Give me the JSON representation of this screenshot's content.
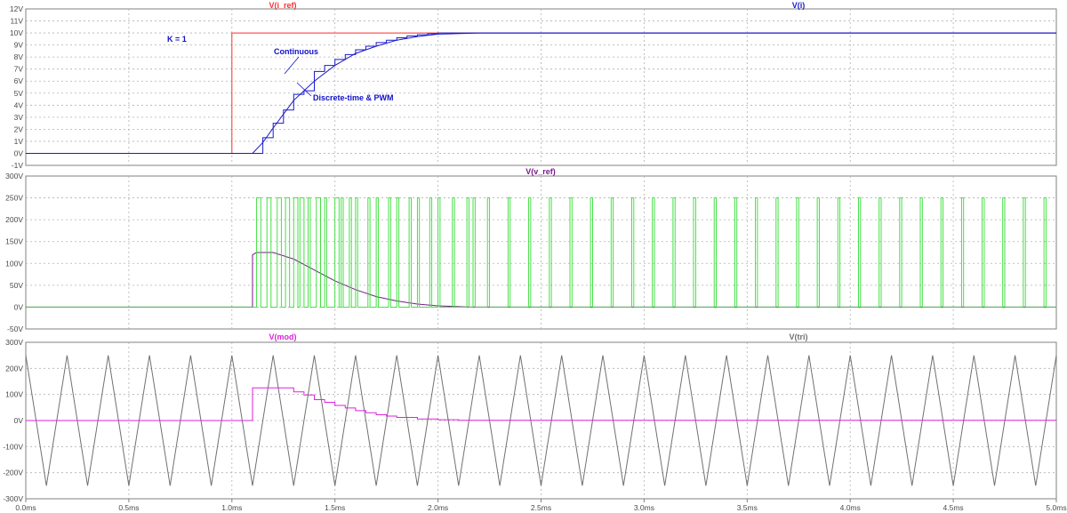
{
  "chart_data": [
    {
      "type": "line",
      "title_left": "V(i_ref)",
      "title_right": "V(i)",
      "x_unit": "ms",
      "y_unit": "V",
      "xlim": [
        0,
        5
      ],
      "ylim": [
        -1,
        12
      ],
      "yticks": [
        -1,
        0,
        1,
        2,
        3,
        4,
        5,
        6,
        7,
        8,
        9,
        10,
        11,
        12
      ],
      "grid": true,
      "annotations": [
        "K = 1",
        "Continuous",
        "Discrete-time & PWM"
      ],
      "series": [
        {
          "name": "V(i_ref)",
          "color": "#ff3030",
          "style": "line",
          "x": [
            0,
            1.0,
            1.0,
            5.0
          ],
          "y": [
            0,
            0,
            10,
            10
          ]
        },
        {
          "name": "V(i)",
          "color": "#1a1acc",
          "style": "line",
          "x": [
            0,
            1.1,
            1.15,
            1.2,
            1.3,
            1.4,
            1.5,
            1.6,
            1.7,
            1.8,
            1.9,
            2.0,
            2.2,
            5.0
          ],
          "y": [
            0,
            0,
            0.9,
            2.1,
            4.4,
            6.0,
            7.3,
            8.3,
            8.9,
            9.4,
            9.7,
            9.9,
            10.0,
            10.0
          ]
        },
        {
          "name": "V(i)",
          "color": "#1a1acc",
          "style": "step",
          "x": [
            0,
            1.1,
            1.15,
            1.2,
            1.25,
            1.3,
            1.35,
            1.4,
            1.45,
            1.5,
            1.55,
            1.6,
            1.65,
            1.7,
            1.75,
            1.8,
            1.85,
            1.9,
            1.95,
            2.0,
            5.0
          ],
          "y": [
            0,
            0,
            1.3,
            2.5,
            3.6,
            4.9,
            5.2,
            6.8,
            7.3,
            7.8,
            8.2,
            8.6,
            8.9,
            9.2,
            9.4,
            9.6,
            9.75,
            9.85,
            9.93,
            10.0,
            10.0
          ]
        }
      ]
    },
    {
      "type": "line",
      "title": "V(v_ref)",
      "x_unit": "ms",
      "y_unit": "V",
      "xlim": [
        0,
        5
      ],
      "ylim": [
        -50,
        300
      ],
      "yticks": [
        -50,
        0,
        50,
        100,
        150,
        200,
        250,
        300
      ],
      "grid": true,
      "series": [
        {
          "name": "V(v_ref)",
          "color": "#7a1a8a",
          "style": "line",
          "x": [
            0,
            1.1,
            1.1,
            1.12,
            1.2,
            1.3,
            1.4,
            1.5,
            1.6,
            1.7,
            1.8,
            1.9,
            2.0,
            2.1,
            2.15,
            5.0
          ],
          "y": [
            0,
            0,
            120,
            125,
            125,
            110,
            85,
            60,
            40,
            24,
            14,
            7,
            3,
            1,
            0,
            0
          ]
        },
        {
          "name": "PWM",
          "color": "#33dd33",
          "style": "pulses",
          "level": 250,
          "pulses": [
            [
              1.12,
              1.14
            ],
            [
              1.17,
              1.19
            ],
            [
              1.22,
              1.24
            ],
            [
              1.26,
              1.28
            ],
            [
              1.3,
              1.32
            ],
            [
              1.33,
              1.35
            ],
            [
              1.37,
              1.38
            ],
            [
              1.41,
              1.43
            ],
            [
              1.45,
              1.46
            ],
            [
              1.5,
              1.52
            ],
            [
              1.53,
              1.54
            ],
            [
              1.57,
              1.58
            ],
            [
              1.6,
              1.61
            ],
            [
              1.66,
              1.67
            ],
            [
              1.7,
              1.71
            ],
            [
              1.76,
              1.77
            ],
            [
              1.8,
              1.81
            ],
            [
              1.86,
              1.87
            ],
            [
              1.9,
              1.91
            ],
            [
              1.96,
              1.97
            ],
            [
              2.0,
              2.01
            ],
            [
              2.07,
              2.08
            ],
            [
              2.14,
              2.15
            ],
            [
              2.17,
              2.18
            ],
            [
              2.24,
              2.25
            ],
            [
              2.34,
              2.35
            ],
            [
              2.44,
              2.45
            ],
            [
              2.54,
              2.55
            ],
            [
              2.64,
              2.65
            ],
            [
              2.74,
              2.75
            ],
            [
              2.84,
              2.85
            ],
            [
              2.94,
              2.95
            ],
            [
              3.04,
              3.05
            ],
            [
              3.14,
              3.15
            ],
            [
              3.24,
              3.25
            ],
            [
              3.34,
              3.35
            ],
            [
              3.44,
              3.45
            ],
            [
              3.54,
              3.55
            ],
            [
              3.64,
              3.65
            ],
            [
              3.74,
              3.75
            ],
            [
              3.84,
              3.85
            ],
            [
              3.94,
              3.95
            ],
            [
              4.04,
              4.05
            ],
            [
              4.14,
              4.15
            ],
            [
              4.24,
              4.25
            ],
            [
              4.34,
              4.35
            ],
            [
              4.44,
              4.45
            ],
            [
              4.54,
              4.55
            ],
            [
              4.64,
              4.65
            ],
            [
              4.74,
              4.75
            ],
            [
              4.84,
              4.85
            ],
            [
              4.94,
              4.95
            ]
          ]
        }
      ]
    },
    {
      "type": "line",
      "title_left": "V(mod)",
      "title_right": "V(tri)",
      "x_unit": "ms",
      "y_unit": "V",
      "xlim": [
        0,
        5
      ],
      "ylim": [
        -300,
        300
      ],
      "yticks": [
        -300,
        -200,
        -100,
        0,
        100,
        200,
        300
      ],
      "grid": true,
      "series": [
        {
          "name": "V(tri)",
          "color": "#707070",
          "style": "triangle",
          "period": 0.2,
          "amplitude": 250,
          "phase": 0
        },
        {
          "name": "V(mod)",
          "color": "#dd22dd",
          "style": "step",
          "x": [
            0,
            1.1,
            1.1,
            1.2,
            1.3,
            1.35,
            1.4,
            1.45,
            1.5,
            1.55,
            1.6,
            1.65,
            1.7,
            1.75,
            1.8,
            1.9,
            2.0,
            2.1,
            5.0
          ],
          "y": [
            0,
            0,
            125,
            125,
            110,
            98,
            80,
            70,
            58,
            48,
            38,
            30,
            22,
            17,
            12,
            6,
            3,
            1,
            0
          ]
        }
      ]
    }
  ],
  "x_axis": {
    "ticks": [
      0,
      0.5,
      1.0,
      1.5,
      2.0,
      2.5,
      3.0,
      3.5,
      4.0,
      4.5,
      5.0
    ],
    "labels": [
      "0.0ms",
      "0.5ms",
      "1.0ms",
      "1.5ms",
      "2.0ms",
      "2.5ms",
      "3.0ms",
      "3.5ms",
      "4.0ms",
      "4.5ms",
      "5.0ms"
    ]
  },
  "colors": {
    "grid": "#b0b0b0",
    "frame": "#808080",
    "annotation": "#1010c8"
  }
}
